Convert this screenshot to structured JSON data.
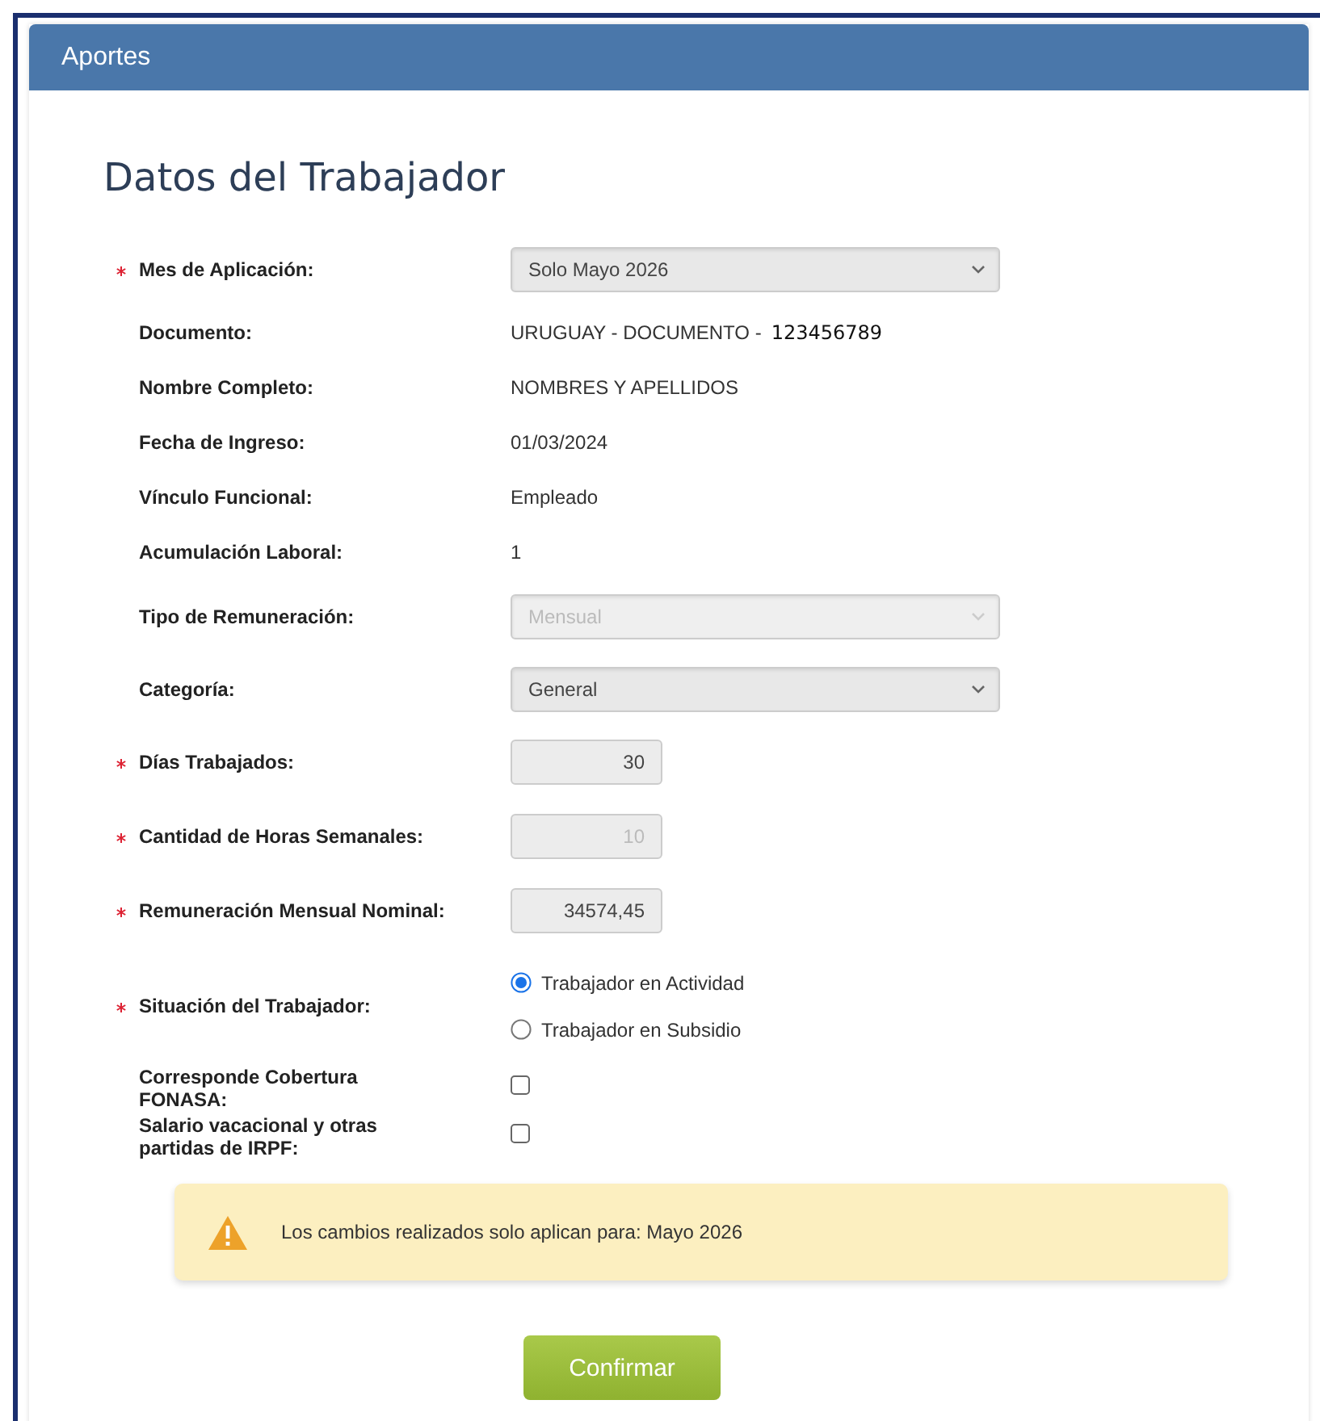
{
  "panel": {
    "title": "Aportes"
  },
  "heading": "Datos del Trabajador",
  "fields": [
    {
      "kind": "select",
      "label": "Mes de Aplicación:",
      "required": true,
      "value": "Solo Mayo 2026",
      "disabled": false
    },
    {
      "kind": "text",
      "label": "Documento:",
      "required": false,
      "value": "URUGUAY - DOCUMENTO -",
      "extra": "123456789"
    },
    {
      "kind": "text",
      "label": "Nombre Completo:",
      "required": false,
      "value": "NOMBRES Y APELLIDOS"
    },
    {
      "kind": "text",
      "label": "Fecha de Ingreso:",
      "required": false,
      "value": "01/03/2024"
    },
    {
      "kind": "text",
      "label": "Vínculo Funcional:",
      "required": false,
      "value": "Empleado"
    },
    {
      "kind": "text",
      "label": "Acumulación Laboral:",
      "required": false,
      "value": "1"
    },
    {
      "kind": "select",
      "label": "Tipo de Remuneración:",
      "required": false,
      "value": "Mensual",
      "disabled": true
    },
    {
      "kind": "select",
      "label": "Categoría:",
      "required": false,
      "value": "General",
      "disabled": false
    },
    {
      "kind": "input",
      "label": "Días Trabajados:",
      "required": true,
      "value": "30",
      "disabled": false
    },
    {
      "kind": "input",
      "label": "Cantidad de Horas Semanales:",
      "required": true,
      "value": "10",
      "disabled": true
    },
    {
      "kind": "input",
      "label": "Remuneración Mensual Nominal:",
      "required": true,
      "value": "34574,45",
      "disabled": false
    },
    {
      "kind": "radio",
      "label": "Situación del Trabajador:",
      "required": true,
      "options": [
        {
          "label": "Trabajador en Actividad",
          "selected": true
        },
        {
          "label": "Trabajador en Subsidio",
          "selected": false
        }
      ]
    },
    {
      "kind": "checkbox",
      "label": "Corresponde Cobertura FONASA:",
      "required": false,
      "checked": false
    },
    {
      "kind": "checkbox",
      "label": "Salario vacacional y otras partidas de IRPF:",
      "required": false,
      "checked": false
    }
  ],
  "alert": {
    "message": "Los cambios realizados solo aplican para: Mayo 2026"
  },
  "button": "Confirmar"
}
